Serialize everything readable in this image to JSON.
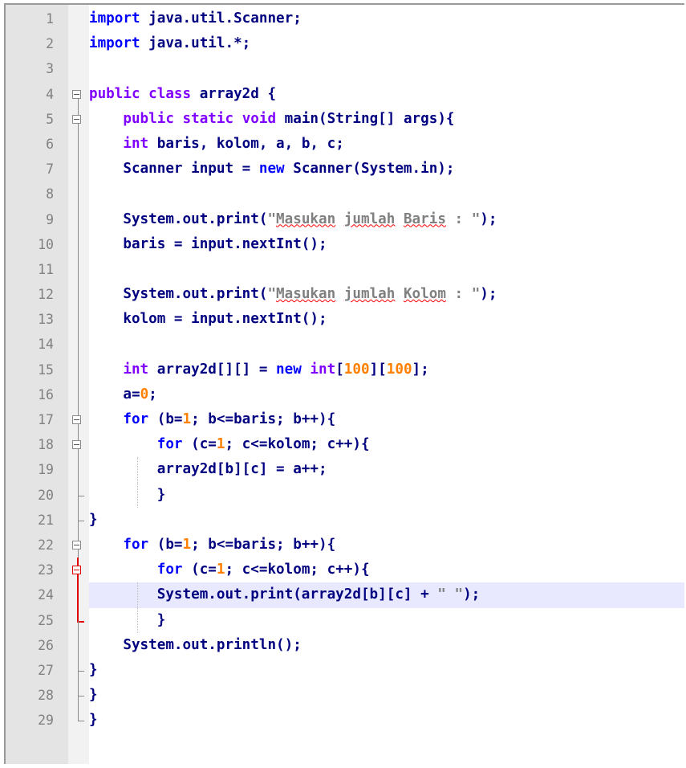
{
  "editor": {
    "lines": [
      {
        "n": "1",
        "t": "import java.util.Scanner;"
      },
      {
        "n": "2",
        "t": "import java.util.*;"
      },
      {
        "n": "3",
        "t": ""
      },
      {
        "n": "4",
        "t": "public class array2d {"
      },
      {
        "n": "5",
        "t": "    public static void main(String[] args){"
      },
      {
        "n": "6",
        "t": "    int baris, kolom, a, b, c;"
      },
      {
        "n": "7",
        "t": "    Scanner input = new Scanner(System.in);"
      },
      {
        "n": "8",
        "t": ""
      },
      {
        "n": "9",
        "t": "    System.out.print(\"Masukan jumlah Baris : \");"
      },
      {
        "n": "10",
        "t": "    baris = input.nextInt();"
      },
      {
        "n": "11",
        "t": ""
      },
      {
        "n": "12",
        "t": "    System.out.print(\"Masukan jumlah Kolom : \");"
      },
      {
        "n": "13",
        "t": "    kolom = input.nextInt();"
      },
      {
        "n": "14",
        "t": ""
      },
      {
        "n": "15",
        "t": "    int array2d[][] = new int[100][100];"
      },
      {
        "n": "16",
        "t": "    a=0;"
      },
      {
        "n": "17",
        "t": "    for (b=1; b<=baris; b++){"
      },
      {
        "n": "18",
        "t": "        for (c=1; c<=kolom; c++){"
      },
      {
        "n": "19",
        "t": "        array2d[b][c] = a++;"
      },
      {
        "n": "20",
        "t": "        }"
      },
      {
        "n": "21",
        "t": "}"
      },
      {
        "n": "22",
        "t": "    for (b=1; b<=baris; b++){"
      },
      {
        "n": "23",
        "t": "        for (c=1; c<=kolom; c++){"
      },
      {
        "n": "24",
        "t": "        System.out.print(array2d[b][c] + \" \");"
      },
      {
        "n": "25",
        "t": "        }"
      },
      {
        "n": "26",
        "t": "    System.out.println();"
      },
      {
        "n": "27",
        "t": "}"
      },
      {
        "n": "28",
        "t": "}"
      },
      {
        "n": "29",
        "t": "}"
      }
    ],
    "active_line": "24",
    "colors": {
      "keyword": "#8000ff",
      "keyword_blue": "#0000ff",
      "number": "#ff8000",
      "string": "#808080",
      "default": "#000080",
      "active_line_bg": "#e8e8ff",
      "gutter_bg": "#e4e4e4"
    }
  }
}
